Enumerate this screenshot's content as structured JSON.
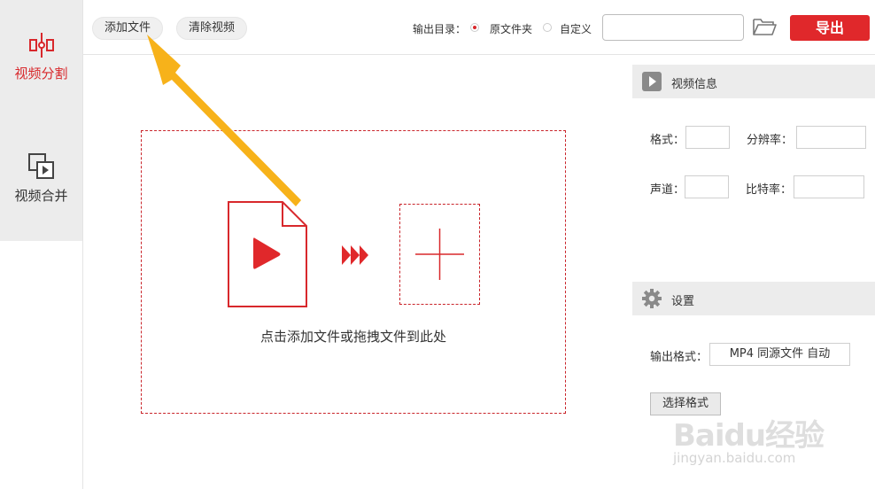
{
  "sidebar": {
    "items": [
      {
        "label": "视频分割",
        "icon": "split-icon",
        "active": true
      },
      {
        "label": "视频合并",
        "icon": "merge-icon",
        "active": false
      }
    ]
  },
  "toolbar": {
    "add_file_label": "添加文件",
    "clear_video_label": "清除视频",
    "output_dir_label": "输出目录：",
    "radio_original": "原文件夹",
    "radio_custom": "自定义",
    "selected_output": "原文件夹",
    "path_value": "",
    "export_label": "导出"
  },
  "dropzone": {
    "hint": "点击添加文件或拖拽文件到此处"
  },
  "video_info": {
    "title": "视频信息",
    "format_label": "格式：",
    "resolution_label": "分辨率：",
    "channel_label": "声道：",
    "bitrate_label": "比特率：",
    "format_value": "",
    "resolution_value": "",
    "channel_value": "",
    "bitrate_value": ""
  },
  "settings": {
    "title": "设置",
    "output_format_label": "输出格式：",
    "output_format_value": "MP4 同源文件 自动",
    "choose_format_label": "选择格式"
  },
  "watermark": {
    "logo": "Baidu经验",
    "sub": "jingyan.baidu.com"
  },
  "colors": {
    "accent": "#d8282c",
    "export_bg": "#e0282b",
    "annotation_arrow": "#f7b21a"
  }
}
